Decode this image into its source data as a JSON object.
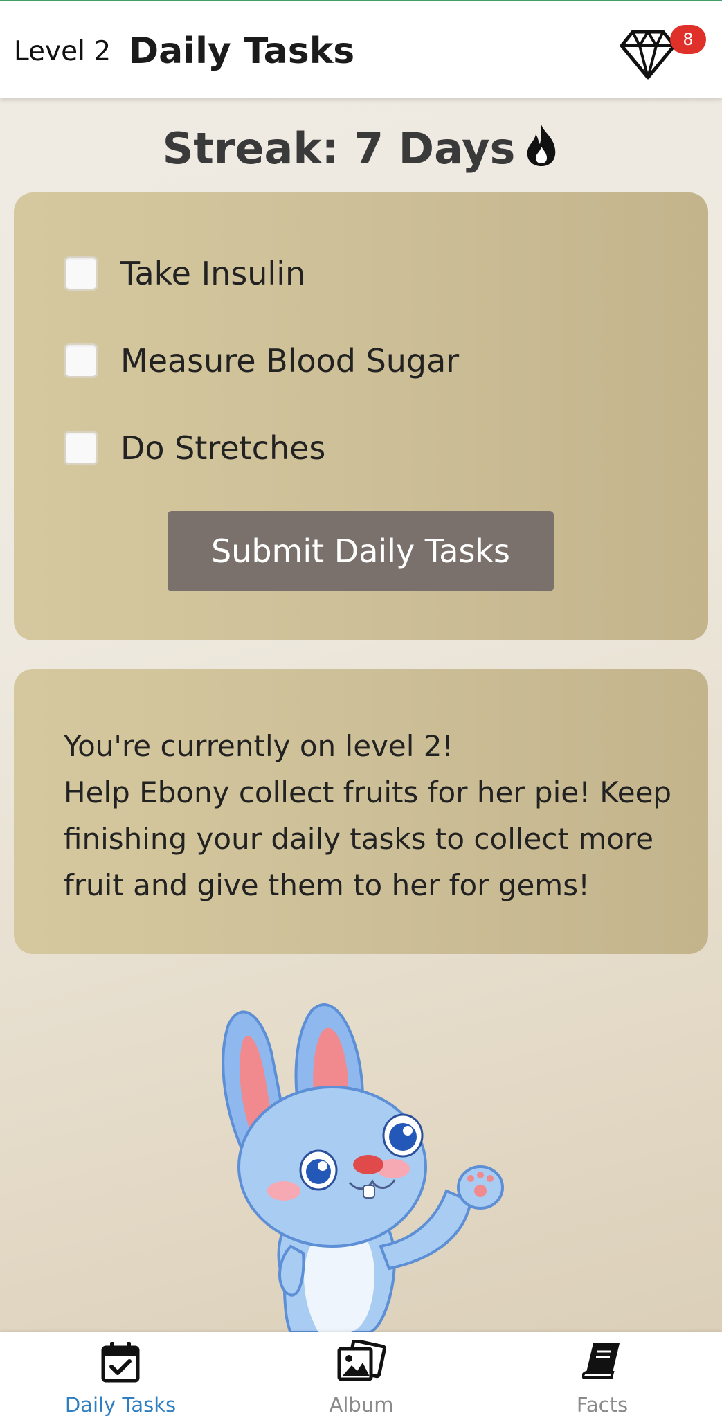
{
  "header": {
    "level_label": "Level 2",
    "title": "Daily Tasks",
    "gem_count": "8"
  },
  "streak": {
    "text": "Streak: 7 Days"
  },
  "tasks": {
    "items": [
      {
        "label": "Take Insulin",
        "checked": false
      },
      {
        "label": "Measure Blood Sugar",
        "checked": false
      },
      {
        "label": "Do Stretches",
        "checked": false
      }
    ],
    "submit_label": "Submit Daily Tasks"
  },
  "info": {
    "line1": "You're currently on level 2!",
    "line2": "Help Ebony collect fruits for her pie! Keep finishing your daily tasks to collect more fruit and give them to her for gems!"
  },
  "nav": {
    "items": [
      {
        "label": "Daily Tasks",
        "icon": "calendar-check-icon",
        "active": true
      },
      {
        "label": "Album",
        "icon": "photos-icon",
        "active": false
      },
      {
        "label": "Facts",
        "icon": "book-icon",
        "active": false
      }
    ]
  },
  "colors": {
    "card": "#cdbf97",
    "submit_button": "#7a716c",
    "badge": "#e0302a",
    "nav_active": "#2f7fc1"
  }
}
